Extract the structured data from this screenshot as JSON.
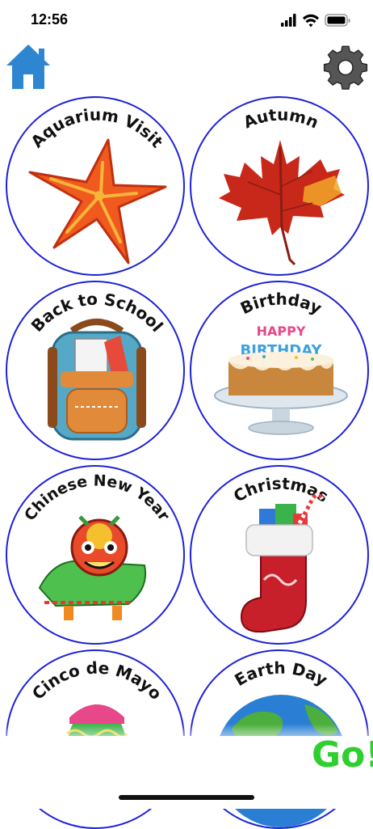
{
  "status_bar": {
    "time": "12:56"
  },
  "nav": {
    "home_icon": "home-icon",
    "settings_icon": "gear-icon"
  },
  "colors": {
    "tile_border": "#1e22d6",
    "go_text": "#2fcf2f",
    "home_blue": "#2e86d1"
  },
  "tiles": [
    {
      "label": "Aquarium Visit",
      "icon": "starfish-icon"
    },
    {
      "label": "Autumn",
      "icon": "maple-leaf-icon"
    },
    {
      "label": "Back to School",
      "icon": "backpack-icon"
    },
    {
      "label": "Birthday",
      "icon": "birthday-cake-icon",
      "cake_text": [
        "HAPPY",
        "BIRTHDAY"
      ]
    },
    {
      "label": "Chinese New Year",
      "icon": "lion-dance-icon"
    },
    {
      "label": "Christmas",
      "icon": "stocking-icon"
    },
    {
      "label": "Cinco de Mayo",
      "icon": "decorated-egg-icon"
    },
    {
      "label": "Earth Day",
      "icon": "globe-icon"
    }
  ],
  "go_button": {
    "label": "Go!"
  }
}
